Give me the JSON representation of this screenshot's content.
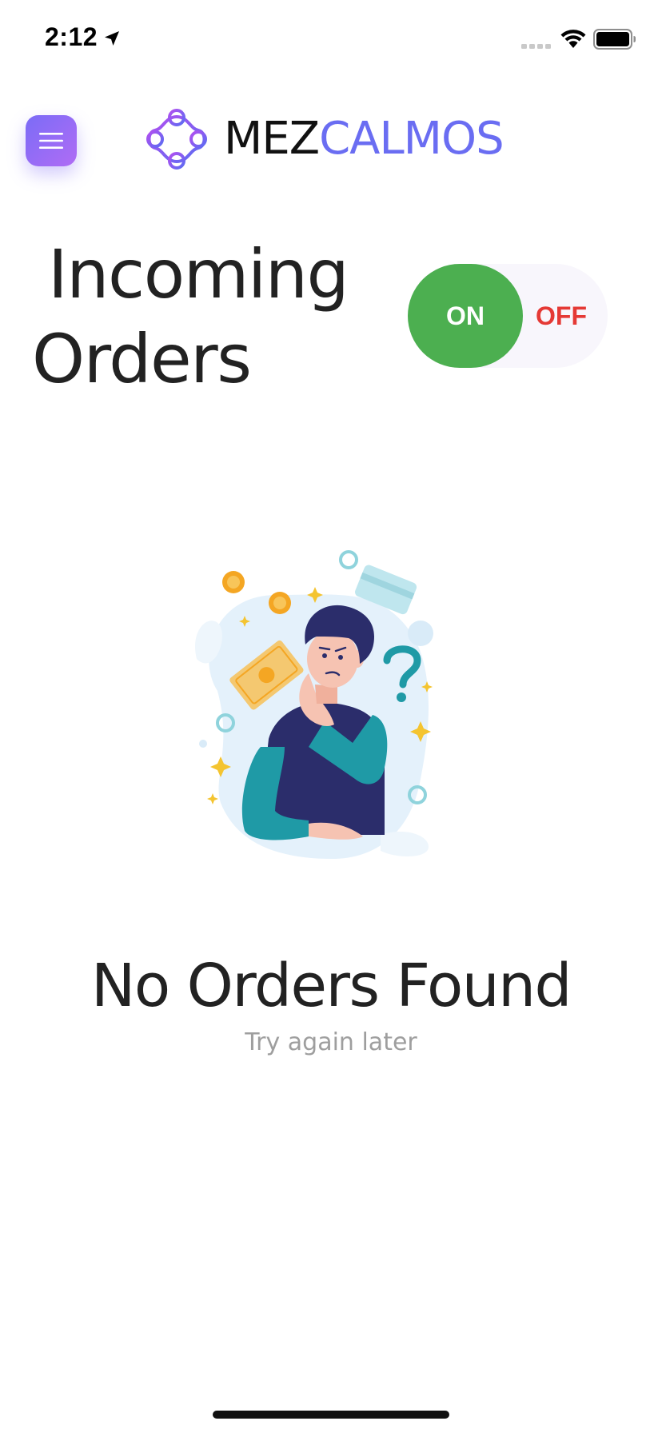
{
  "status_bar": {
    "time": "2:12",
    "icons": [
      "location-arrow-icon",
      "cellular-signal-icon",
      "wifi-icon",
      "battery-icon"
    ]
  },
  "header": {
    "menu_icon": "hamburger-menu-icon",
    "brand_logo_icon": "mezcalmos-logo-icon",
    "brand_part_1": "MEZ",
    "brand_part_2": "CALMOS",
    "colors": {
      "brand_dark": "#111111",
      "brand_accent": "#6a6df2",
      "menu_gradient_start": "#7b6cf6",
      "menu_gradient_end": "#b06cf5"
    }
  },
  "main": {
    "title_line_1": "Incoming",
    "title_line_2": "Orders",
    "toggle": {
      "on_label": "ON",
      "off_label": "OFF",
      "state": "on",
      "on_color": "#4caf50",
      "off_color": "#e53935"
    },
    "empty_state": {
      "illustration": "thinking-person-illustration",
      "title": "No Orders Found",
      "subtitle": "Try again later"
    }
  }
}
